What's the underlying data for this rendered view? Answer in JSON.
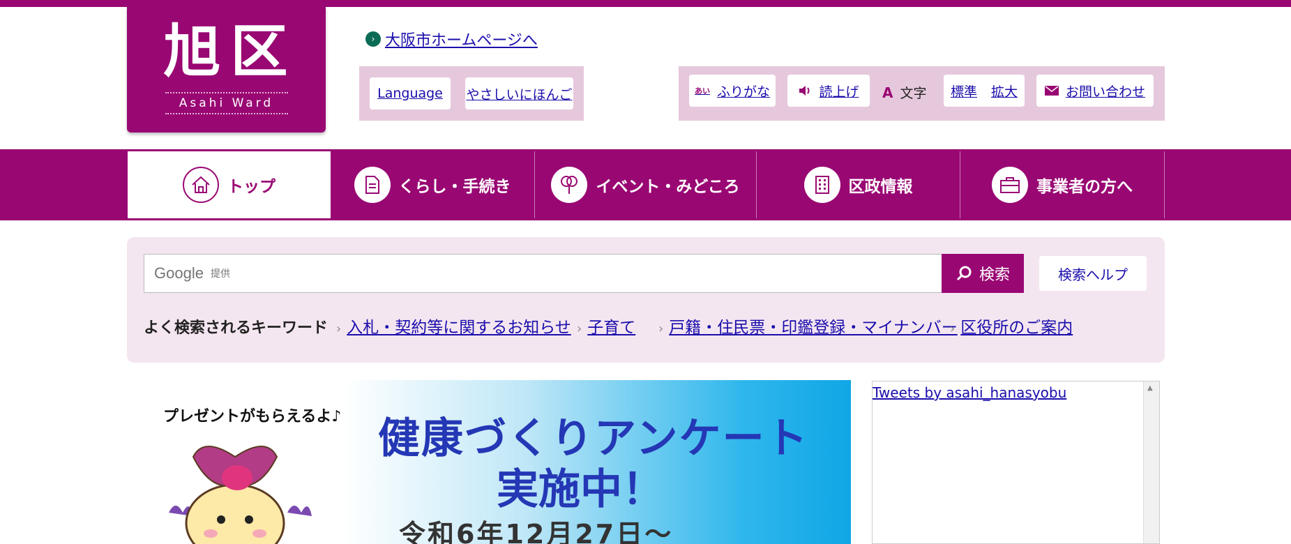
{
  "logo": {
    "ja": "旭区",
    "en": "Asahi Ward"
  },
  "header": {
    "home_link": "大阪市ホームページへ",
    "language_btn": "Language",
    "easy_japanese_btn": "やさしいにほんご",
    "furigana_btn": "ふりがな",
    "furigana_icon_text": "あい",
    "read_aloud_btn": "読上げ",
    "text_size_label": "文字",
    "text_size_standard": "標準",
    "text_size_large": "拡大",
    "contact_btn": "お問い合わせ"
  },
  "nav": {
    "items": [
      {
        "label": "トップ",
        "icon": "home-icon"
      },
      {
        "label": "くらし・手続き",
        "icon": "document-icon"
      },
      {
        "label": "イベント・みどころ",
        "icon": "balloon-icon"
      },
      {
        "label": "区政情報",
        "icon": "building-icon"
      },
      {
        "label": "事業者の方へ",
        "icon": "briefcase-icon"
      }
    ]
  },
  "search": {
    "google": "Google",
    "provided": "提供",
    "button": "検索",
    "help": "検索ヘルプ",
    "keywords_label": "よく検索されるキーワード",
    "keywords": [
      "入札・契約等に関するお知らせ",
      "子育て",
      "戸籍・住民票・印鑑登録・マイナンバー",
      "区役所のご案内"
    ]
  },
  "banner": {
    "present": "プレゼントがもらえるよ♪",
    "title1": "健康づくりアンケート",
    "title2": "実施中！",
    "date": "令和6年12月27日～"
  },
  "twitter": {
    "link": "Tweets by asahi_hanasyobu"
  },
  "colors": {
    "brand": "#990773",
    "link": "#1a0dab",
    "panel": "#f4e6f0"
  }
}
